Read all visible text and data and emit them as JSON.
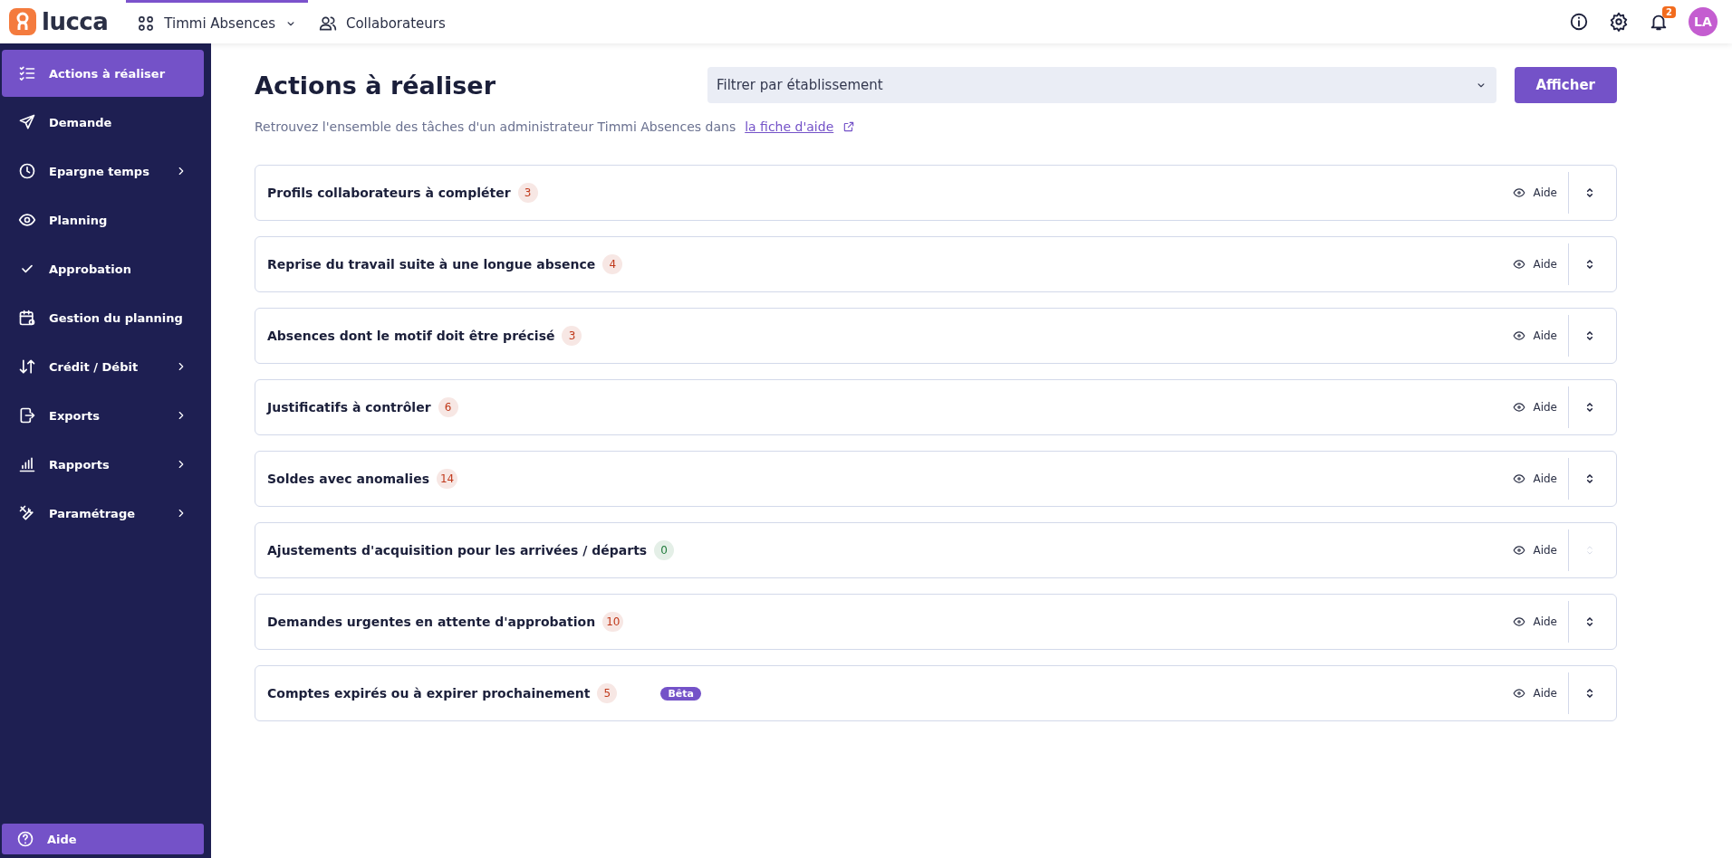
{
  "topbar": {
    "logo": "lucca",
    "nav": [
      {
        "label": "Timmi Absences",
        "kind": "apps",
        "selected": true
      },
      {
        "label": "Collaborateurs",
        "kind": "people",
        "selected": false
      }
    ],
    "notifications_count": "2",
    "avatar": "LA"
  },
  "sidebar": {
    "items": [
      {
        "label": "Actions à réaliser",
        "selected": true,
        "expandable": false
      },
      {
        "label": "Demande",
        "selected": false,
        "expandable": false
      },
      {
        "label": "Epargne temps",
        "selected": false,
        "expandable": true
      },
      {
        "label": "Planning",
        "selected": false,
        "expandable": false
      },
      {
        "label": "Approbation",
        "selected": false,
        "expandable": false
      },
      {
        "label": "Gestion du planning",
        "selected": false,
        "expandable": false
      },
      {
        "label": "Crédit / Débit",
        "selected": false,
        "expandable": true
      },
      {
        "label": "Exports",
        "selected": false,
        "expandable": true
      },
      {
        "label": "Rapports",
        "selected": false,
        "expandable": true
      },
      {
        "label": "Paramétrage",
        "selected": false,
        "expandable": true
      }
    ],
    "help_button": "Aide"
  },
  "page": {
    "title": "Actions à réaliser",
    "filter": {
      "placeholder": "Filtrer par établissement"
    },
    "show_button": "Afficher",
    "intro": "Retrouvez l'ensemble des tâches d'un administrateur Timmi Absences dans",
    "intro_link": "la fiche d'aide",
    "tasks": [
      {
        "title": "Profils collaborateurs à compléter",
        "count": "3",
        "color": "#c0391b",
        "help": "Aide",
        "disabled": false
      },
      {
        "title": "Reprise du travail suite à une longue absence",
        "count": "4",
        "color": "#c0391b",
        "help": "Aide",
        "disabled": false
      },
      {
        "title": "Absences dont le motif doit être précisé",
        "count": "3",
        "color": "#c0391b",
        "help": "Aide",
        "disabled": false
      },
      {
        "title": "Justificatifs à contrôler",
        "count": "6",
        "color": "#c0391b",
        "help": "Aide",
        "disabled": false
      },
      {
        "title": "Soldes avec anomalies",
        "count": "14",
        "color": "#c0391b",
        "help": "Aide",
        "disabled": false
      },
      {
        "title": "Ajustements d'acquisition pour les arrivées / départs",
        "count": "0",
        "color": "#1f7a3a",
        "help": "Aide",
        "disabled": true
      },
      {
        "title": "Demandes urgentes en attente d'approbation",
        "count": "10",
        "color": "#c0391b",
        "help": "Aide",
        "disabled": false
      },
      {
        "title": "Comptes expirés ou à expirer prochainement",
        "count": "5",
        "color": "#c0391b",
        "help": "Aide",
        "disabled": false,
        "tag": "Bêta"
      }
    ]
  }
}
